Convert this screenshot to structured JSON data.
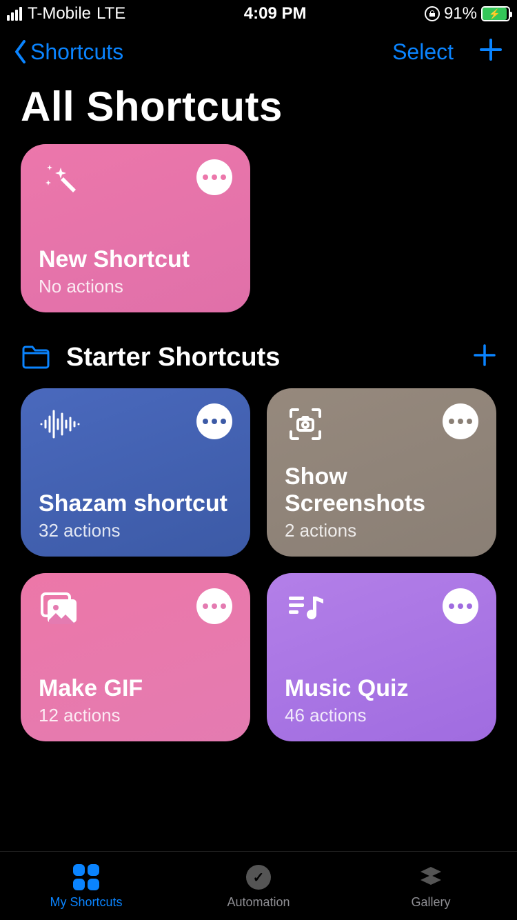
{
  "status": {
    "carrier": "T-Mobile",
    "network": "LTE",
    "time": "4:09 PM",
    "battery_pct": "91%"
  },
  "nav": {
    "back_label": "Shortcuts",
    "select_label": "Select"
  },
  "title": "All Shortcuts",
  "top_card": {
    "title": "New Shortcut",
    "subtitle": "No actions"
  },
  "section": {
    "title": "Starter Shortcuts"
  },
  "cards": [
    {
      "title": "Shazam shortcut",
      "subtitle": "32 actions"
    },
    {
      "title": "Show Screenshots",
      "subtitle": "2 actions"
    },
    {
      "title": "Make GIF",
      "subtitle": "12 actions"
    },
    {
      "title": "Music Quiz",
      "subtitle": "46 actions"
    }
  ],
  "tabs": {
    "my": "My Shortcuts",
    "auto": "Automation",
    "gallery": "Gallery"
  }
}
